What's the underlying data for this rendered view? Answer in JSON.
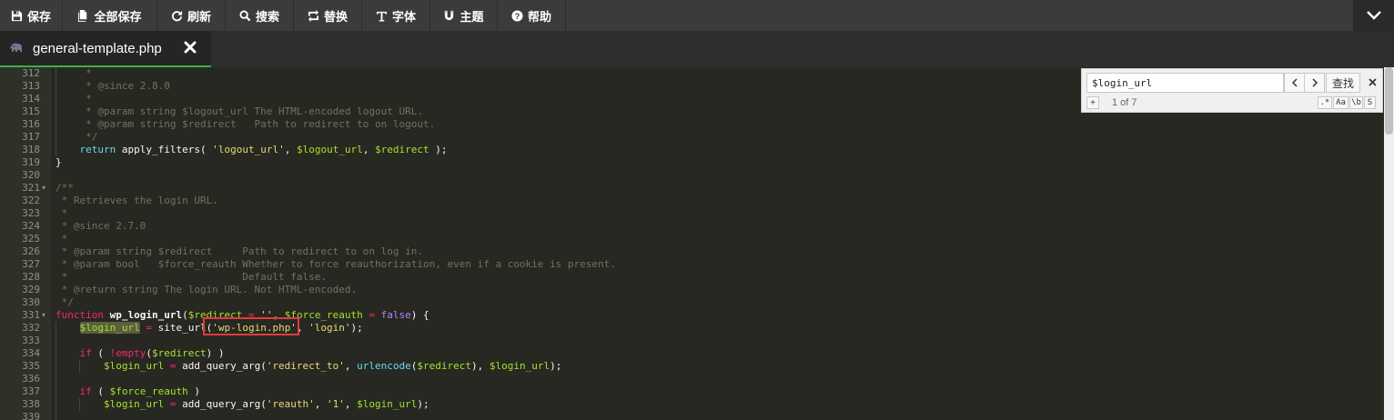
{
  "toolbar": {
    "save": "保存",
    "save_all": "全部保存",
    "refresh": "刷新",
    "search": "搜索",
    "replace": "替换",
    "font": "字体",
    "theme": "主题",
    "help": "帮助"
  },
  "tab": {
    "filename": "general-template.php"
  },
  "search_box": {
    "value": "$login_url",
    "find_label": "查找",
    "result_count": "1 of 7",
    "plus_label": "+",
    "opt_regex": ".*",
    "opt_case": "Aa",
    "opt_word": "\\b",
    "opt_selection": "S"
  },
  "editor": {
    "line_numbers": [
      "312",
      "313",
      "314",
      "315",
      "316",
      "317",
      "318",
      "319",
      "320",
      "321",
      "322",
      "323",
      "324",
      "325",
      "326",
      "327",
      "328",
      "329",
      "330",
      "331",
      "332",
      "333",
      "334",
      "335",
      "336",
      "337",
      "338",
      "339"
    ],
    "fold_lines": [
      "321",
      "331"
    ],
    "lines": {
      "l312": "     *",
      "l313": "     * @since 2.8.0",
      "l314": "     *",
      "l315": "     * @param string $logout_url The HTML-encoded logout URL.",
      "l316": "     * @param string $redirect   Path to redirect to on logout.",
      "l317": "     */",
      "l318_kw": "return",
      "l318_fn": "apply_filters",
      "l318_s": "'logout_url'",
      "l318_v1": "$logout_url",
      "l318_v2": "$redirect",
      "l319": "}",
      "l321": "/**",
      "l322": " * Retrieves the login URL.",
      "l323": " *",
      "l324": " * @since 2.7.0",
      "l325": " *",
      "l326": " * @param string $redirect     Path to redirect to on log in.",
      "l327": " * @param bool   $force_reauth Whether to force reauthorization, even if a cookie is present.",
      "l328": " *                             Default false.",
      "l329": " * @return string The login URL. Not HTML-encoded.",
      "l330": " */",
      "l331_kw": "function",
      "l331_name": "wp_login_url",
      "l331_v1": "$redirect",
      "l331_s": "''",
      "l331_v2": "$force_reauth",
      "l331_b": "false",
      "l332_v": "$login_url",
      "l332_fn": "site_url",
      "l332_s1": "'wp-login.php'",
      "l332_s2": "'login'",
      "l334_kw": "if",
      "l334_fn": "empty",
      "l334_v": "$redirect",
      "l335_v1": "$login_url",
      "l335_fn1": "add_query_arg",
      "l335_s": "'redirect_to'",
      "l335_fn2": "urlencode",
      "l335_v2": "$redirect",
      "l335_v3": "$login_url",
      "l337_kw": "if",
      "l337_v": "$force_reauth",
      "l338_v1": "$login_url",
      "l338_fn": "add_query_arg",
      "l338_s1": "'reauth'",
      "l338_s2": "'1'",
      "l338_v2": "$login_url"
    }
  },
  "colors": {
    "toolbar_bg": "#3b3b3b",
    "editor_bg": "#272822",
    "tab_underline": "#3fae49",
    "highlight_box": "#e23b3b"
  },
  "icons": {
    "save": "floppy-icon",
    "save_all": "files-icon",
    "refresh": "refresh-icon",
    "search": "search-icon",
    "replace": "replace-icon",
    "font": "font-icon",
    "theme": "magnet-icon",
    "help": "help-icon",
    "collapse": "chevron-down-icon",
    "file": "php-elephant-icon",
    "close": "close-icon"
  }
}
